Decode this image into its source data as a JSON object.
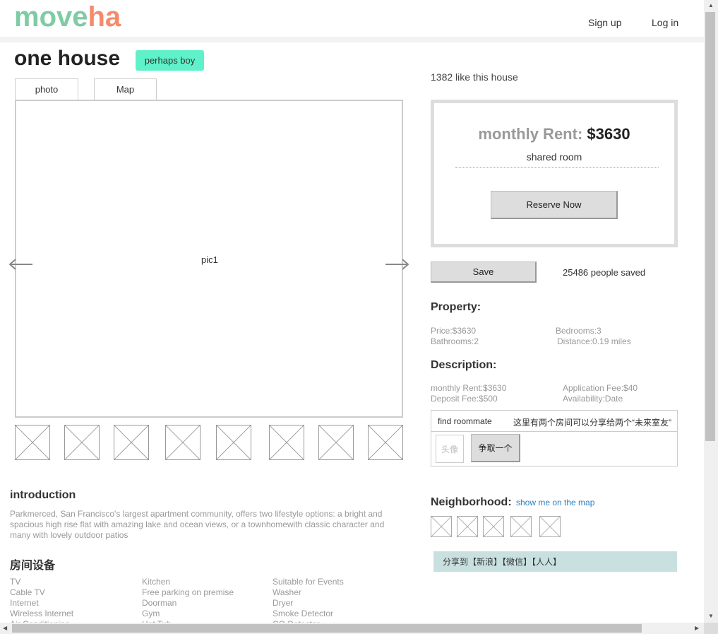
{
  "header": {
    "logo_part1": "move",
    "logo_part2": "ha",
    "signup": "Sign up",
    "login": "Log in",
    "colors": {
      "logo_green": "#7fcba4",
      "logo_orange": "#f58b6c"
    }
  },
  "listing": {
    "title": "one house",
    "tag": "perhaps boy",
    "tabs": [
      "photo",
      "Map"
    ],
    "main_pic": "pic1",
    "likes": "1382 like this house"
  },
  "rent": {
    "label": "monthly Rent:",
    "value": "$3630",
    "room_type": "shared room",
    "reserve": "Reserve Now"
  },
  "save": {
    "button": "Save",
    "saved_text": "25486 people saved"
  },
  "property": {
    "title": "Property:",
    "price": "Price:$3630",
    "bathrooms": "Bathrooms:2",
    "bedrooms": "Bedrooms:3",
    "distance": "Distance:0.19 miles"
  },
  "description": {
    "title": "Description:",
    "monthly_rent": "monthly Rent:$3630",
    "deposit": "Deposit Fee:$500",
    "app_fee": "Application Fee:$40",
    "availability": "Availability:Date"
  },
  "roommate": {
    "find": "find roommate",
    "note": "这里有两个房间可以分享给两个“未来室友”",
    "avatar": "头像",
    "claim": "争取一个"
  },
  "neighborhood": {
    "title": "Neighborhood:",
    "link": "show me on the map"
  },
  "share": {
    "text": "分享到【新浪】【微信】【人人】"
  },
  "intro": {
    "title": "introduction",
    "text": "Parkmerced, San Francisco's largest apartment community, offers two lifestyle options: a bright and spacious high rise flat with amazing lake and ocean views, or a townhomewith classic character and many with lovely outdoor patios"
  },
  "amenities": {
    "title": "房间设备",
    "col1": [
      "TV",
      "Cable TV",
      "Internet",
      "Wireless Internet",
      "Air Conditioning"
    ],
    "col2": [
      "Kitchen",
      "Free parking on premise",
      "Doorman",
      "Gym",
      "Hot Tub"
    ],
    "col3": [
      "Suitable for Events",
      "Washer",
      "Dryer",
      "Smoke Detector",
      "CO Detector"
    ]
  }
}
